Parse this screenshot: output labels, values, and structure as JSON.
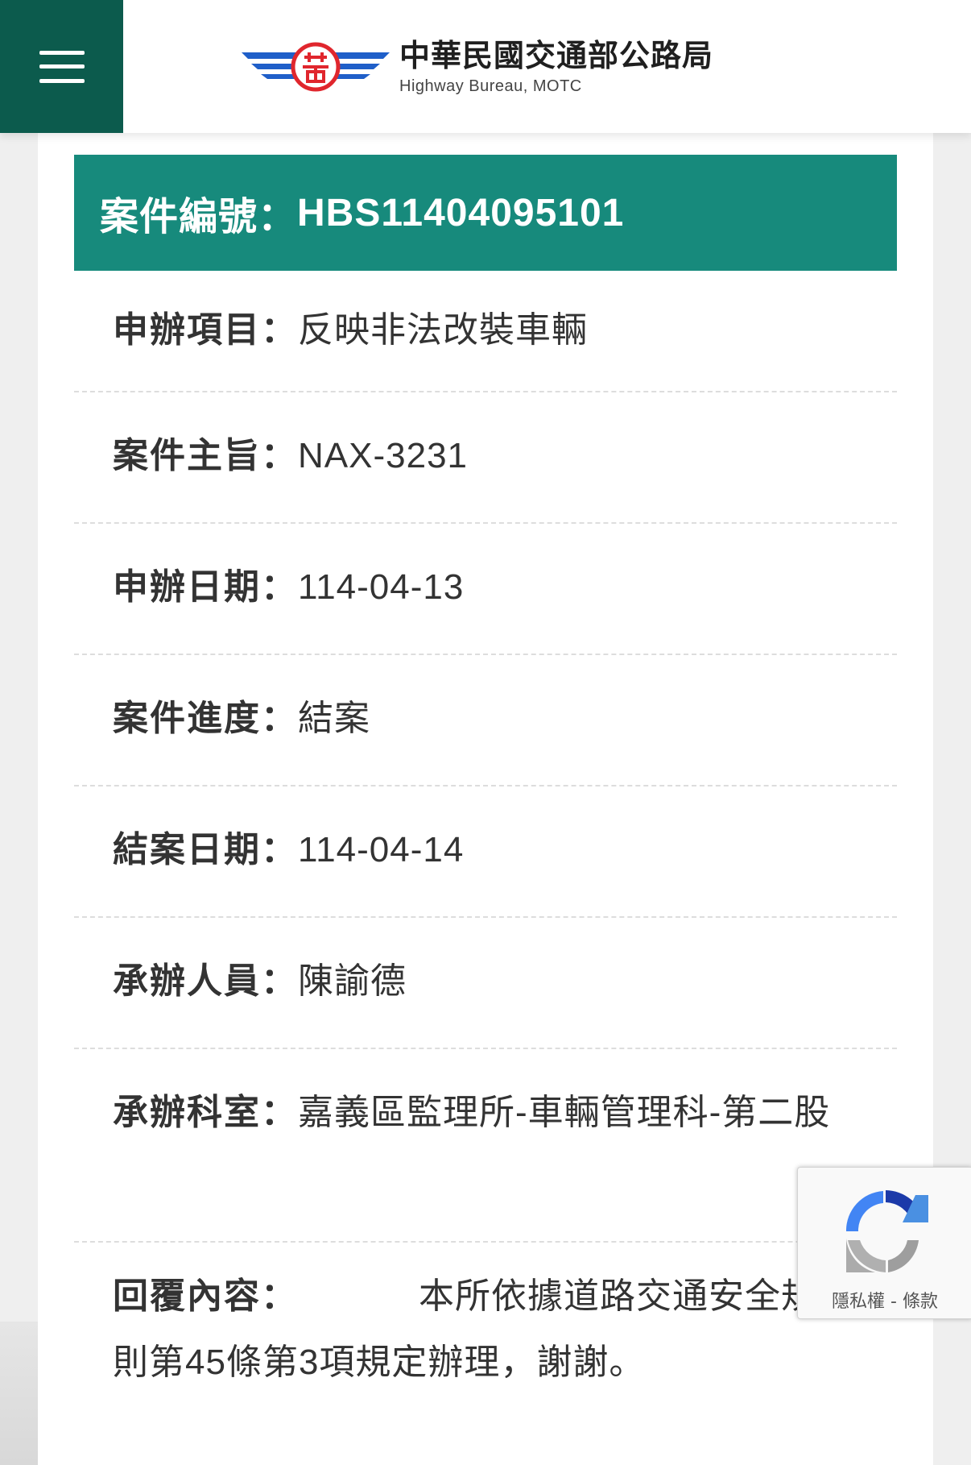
{
  "header": {
    "brand_cn": "中華民國交通部公路局",
    "brand_en": "Highway Bureau, MOTC",
    "menu_icon": "hamburger-menu-icon"
  },
  "case": {
    "number_label": "案件編號：",
    "number_value": "HBS11404095101"
  },
  "fields": [
    {
      "label": "申辦項目：",
      "value": "反映非法改裝車輛"
    },
    {
      "label": "案件主旨：",
      "value": "NAX-3231"
    },
    {
      "label": "申辦日期：",
      "value": "114-04-13"
    },
    {
      "label": "案件進度：",
      "value": "結案"
    },
    {
      "label": "結案日期：",
      "value": "114-04-14"
    },
    {
      "label": "承辦人員：",
      "value": "陳諭德"
    },
    {
      "label": "承辦科室：",
      "value": "嘉義區監理所-車輛管理科-第二股"
    },
    {
      "label": "回覆內容：",
      "value": "本所依據道路交通安全規則第45條第3項規定辦理，謝謝。"
    }
  ],
  "recaptcha": {
    "privacy": "隱私權",
    "separator": " - ",
    "terms": "條款",
    "icon": "recaptcha-icon"
  },
  "colors": {
    "header_green": "#0c5b4d",
    "case_header_teal": "#178a7c",
    "logo_blue": "#1f5fc9",
    "logo_red": "#e0262d"
  }
}
